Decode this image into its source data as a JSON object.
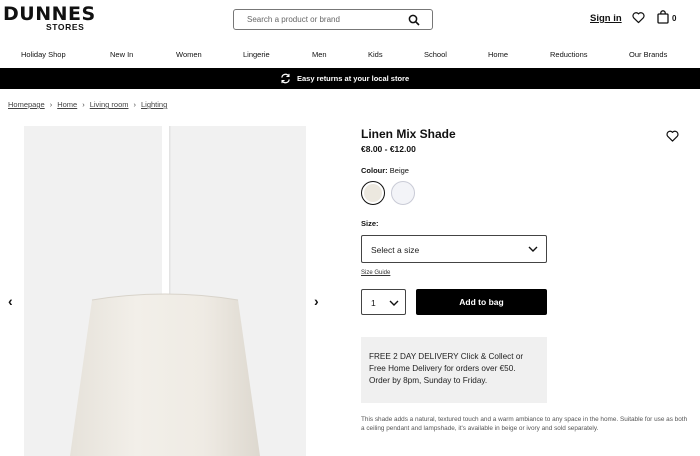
{
  "header": {
    "logo_main": "DUNNES",
    "logo_sub": "STORES",
    "search_placeholder": "Search a product or brand",
    "signin": "Sign in",
    "bag_count": "0"
  },
  "nav": [
    "Holiday Shop",
    "New In",
    "Women",
    "Lingerie",
    "Men",
    "Kids",
    "School",
    "Home",
    "Reductions",
    "Our Brands"
  ],
  "banner": {
    "text": "Easy returns at your local store"
  },
  "breadcrumb": [
    "Homepage",
    "Home",
    "Living room",
    "Lighting"
  ],
  "product": {
    "title": "Linen Mix Shade",
    "price": "€8.00 - €12.00",
    "colour_label": "Colour:",
    "colour_value": "Beige",
    "size_label": "Size:",
    "size_placeholder": "Select a size",
    "size_guide": "Size Guide",
    "quantity": "1",
    "add_to_bag": "Add to bag",
    "delivery_lines": [
      "FREE 2 DAY DELIVERY Click & Collect or",
      "Free Home Delivery for orders over €50.",
      "Order by 8pm, Sunday to Friday."
    ],
    "description": "This shade adds a natural, textured touch and a warm ambiance to any space in the home. Suitable for use as both a ceiling pendant and lampshade, it's available in beige or ivory and sold separately."
  },
  "colors": {
    "banner_bg": "#000000",
    "swatch_beige": "#ece8df",
    "swatch_ivory": "#f3f4f8",
    "image_bg": "#f1f1f1"
  }
}
